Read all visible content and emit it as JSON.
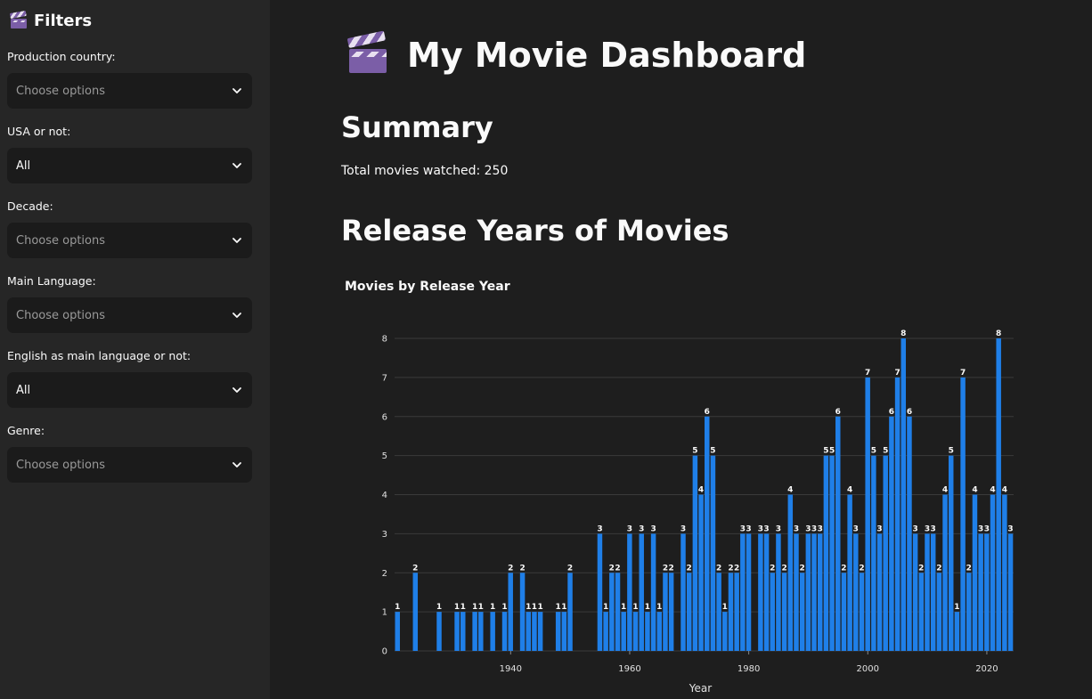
{
  "sidebar": {
    "title": "Filters",
    "filters": [
      {
        "label": "Production country:",
        "value": "Choose options",
        "placeholder": true
      },
      {
        "label": "USA or not:",
        "value": "All",
        "placeholder": false
      },
      {
        "label": "Decade:",
        "value": "Choose options",
        "placeholder": true
      },
      {
        "label": "Main Language:",
        "value": "Choose options",
        "placeholder": true
      },
      {
        "label": "English as main language or not:",
        "value": "All",
        "placeholder": false
      },
      {
        "label": "Genre:",
        "value": "Choose options",
        "placeholder": true
      }
    ]
  },
  "main": {
    "title": "My Movie Dashboard",
    "summary_heading": "Summary",
    "summary_text": "Total movies watched: 250",
    "chart_heading": "Release Years of Movies"
  },
  "colors": {
    "bar": "#1f7fe8",
    "background": "#1e1e1e",
    "sidebar": "#262626"
  },
  "chart_data": {
    "type": "bar",
    "title": "Movies by Release Year",
    "xlabel": "Year",
    "ylabel": "",
    "ylim": [
      0,
      8
    ],
    "xlim": [
      1921,
      2025
    ],
    "yticks": [
      0,
      1,
      2,
      3,
      4,
      5,
      6,
      7,
      8
    ],
    "xticks": [
      1940,
      1960,
      1980,
      2000,
      2020
    ],
    "grid": true,
    "x": [
      1921,
      1924,
      1928,
      1931,
      1932,
      1934,
      1935,
      1937,
      1939,
      1940,
      1942,
      1943,
      1944,
      1945,
      1948,
      1949,
      1950,
      1955,
      1956,
      1957,
      1958,
      1959,
      1960,
      1961,
      1962,
      1963,
      1964,
      1965,
      1966,
      1967,
      1969,
      1970,
      1971,
      1972,
      1973,
      1974,
      1975,
      1976,
      1977,
      1978,
      1979,
      1980,
      1982,
      1983,
      1984,
      1985,
      1986,
      1987,
      1988,
      1989,
      1990,
      1991,
      1992,
      1993,
      1994,
      1995,
      1996,
      1997,
      1998,
      1999,
      2000,
      2001,
      2002,
      2003,
      2004,
      2005,
      2006,
      2007,
      2008,
      2009,
      2010,
      2011,
      2012,
      2013,
      2014,
      2015,
      2016,
      2017,
      2018,
      2019,
      2020,
      2021,
      2022,
      2023,
      2024
    ],
    "values": [
      1,
      2,
      1,
      1,
      1,
      1,
      1,
      1,
      1,
      2,
      2,
      1,
      1,
      1,
      1,
      1,
      2,
      3,
      1,
      2,
      2,
      1,
      3,
      1,
      3,
      1,
      3,
      1,
      2,
      2,
      3,
      2,
      5,
      4,
      6,
      5,
      2,
      1,
      2,
      2,
      3,
      3,
      3,
      3,
      2,
      3,
      2,
      4,
      3,
      2,
      3,
      3,
      3,
      5,
      5,
      6,
      2,
      4,
      3,
      2,
      7,
      5,
      3,
      5,
      6,
      7,
      8,
      6,
      3,
      2,
      3,
      3,
      2,
      4,
      5,
      1,
      7,
      2,
      4,
      3,
      3,
      4,
      8,
      4,
      3
    ]
  }
}
